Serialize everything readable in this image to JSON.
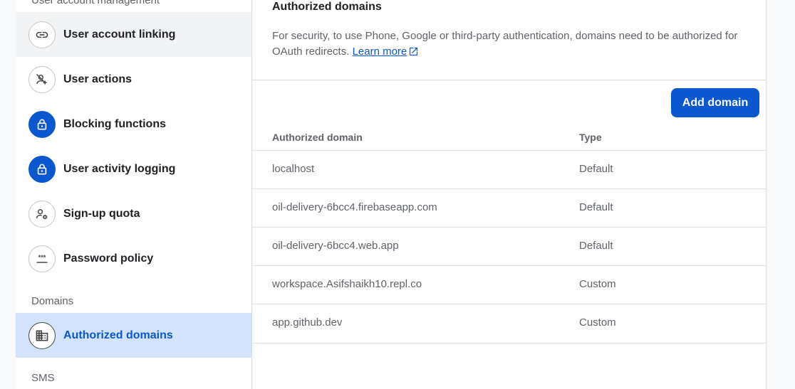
{
  "sidebar": {
    "section_user_mgmt": "User account management",
    "items": [
      {
        "label": "User account linking",
        "icon": "link-icon"
      },
      {
        "label": "User actions",
        "icon": "person-off-icon"
      },
      {
        "label": "Blocking functions",
        "icon": "lock-icon"
      },
      {
        "label": "User activity logging",
        "icon": "lock-icon"
      },
      {
        "label": "Sign-up quota",
        "icon": "manage-accounts-icon"
      },
      {
        "label": "Password policy",
        "icon": "password-icon"
      }
    ],
    "section_domains": "Domains",
    "domains_item": {
      "label": "Authorized domains",
      "icon": "domain-icon"
    },
    "section_sms": "SMS"
  },
  "card": {
    "title": "Authorized domains",
    "description": "For security, to use Phone, Google or third-party authentication, domains need to be authorized for OAuth redirects.",
    "learn_more": "Learn more",
    "add_button": "Add domain"
  },
  "table": {
    "headers": [
      "Authorized domain",
      "Type"
    ],
    "rows": [
      {
        "domain": "localhost",
        "type": "Default"
      },
      {
        "domain": "oil-delivery-6bcc4.firebaseapp.com",
        "type": "Default"
      },
      {
        "domain": "oil-delivery-6bcc4.web.app",
        "type": "Default"
      },
      {
        "domain": "workspace.Asifshaikh10.repl.co",
        "type": "Custom"
      },
      {
        "domain": "app.github.dev",
        "type": "Custom"
      }
    ]
  },
  "colors": {
    "accent": "#0b57d0",
    "selected_bg": "#d3e3fd"
  }
}
